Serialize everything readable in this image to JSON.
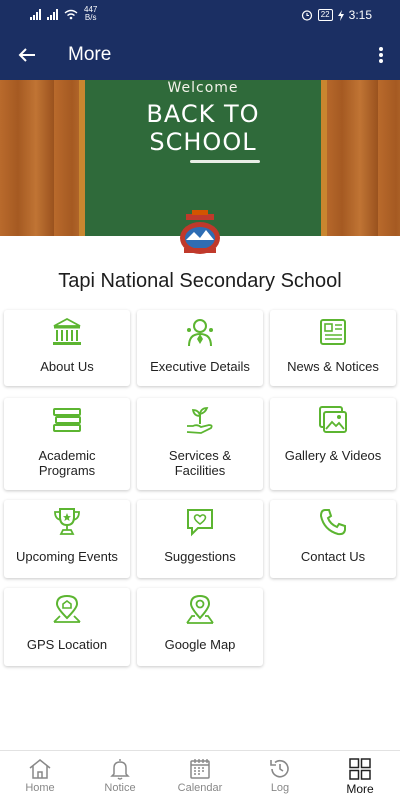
{
  "status_bar": {
    "net_speed_value": "447",
    "net_speed_unit": "B/s",
    "battery": "22",
    "time": "3:15"
  },
  "app_bar": {
    "title": "More",
    "back_icon": "arrow-left-icon",
    "overflow_icon": "more-vert-icon"
  },
  "banner": {
    "welcome": "Welcome",
    "line1": "BACK TO",
    "line2": "SCHOOL"
  },
  "school_name": "Tapi National Secondary School",
  "tiles": [
    {
      "label": "About Us",
      "icon": "institution-icon"
    },
    {
      "label": "Executive Details",
      "icon": "executive-icon"
    },
    {
      "label": "News & Notices",
      "icon": "newspaper-icon"
    },
    {
      "label": "Academic\nPrograms",
      "icon": "books-icon"
    },
    {
      "label": "Services &\nFacilities",
      "icon": "plant-hand-icon"
    },
    {
      "label": "Gallery & Videos",
      "icon": "gallery-icon"
    },
    {
      "label": "Upcoming Events",
      "icon": "trophy-icon"
    },
    {
      "label": "Suggestions",
      "icon": "heart-chat-icon"
    },
    {
      "label": "Contact Us",
      "icon": "phone-icon"
    },
    {
      "label": "GPS Location",
      "icon": "gps-location-icon"
    },
    {
      "label": "Google Map",
      "icon": "map-pin-icon"
    }
  ],
  "bottom_nav": [
    {
      "label": "Home",
      "icon": "home-icon",
      "active": false
    },
    {
      "label": "Notice",
      "icon": "bell-icon",
      "active": false
    },
    {
      "label": "Calendar",
      "icon": "calendar-icon",
      "active": false
    },
    {
      "label": "Log",
      "icon": "history-icon",
      "active": false
    },
    {
      "label": "More",
      "icon": "grid-icon",
      "active": true
    }
  ],
  "colors": {
    "app_bar": "#1b2f63",
    "icon_green": "#5cb531",
    "nav_inactive": "#888888"
  }
}
